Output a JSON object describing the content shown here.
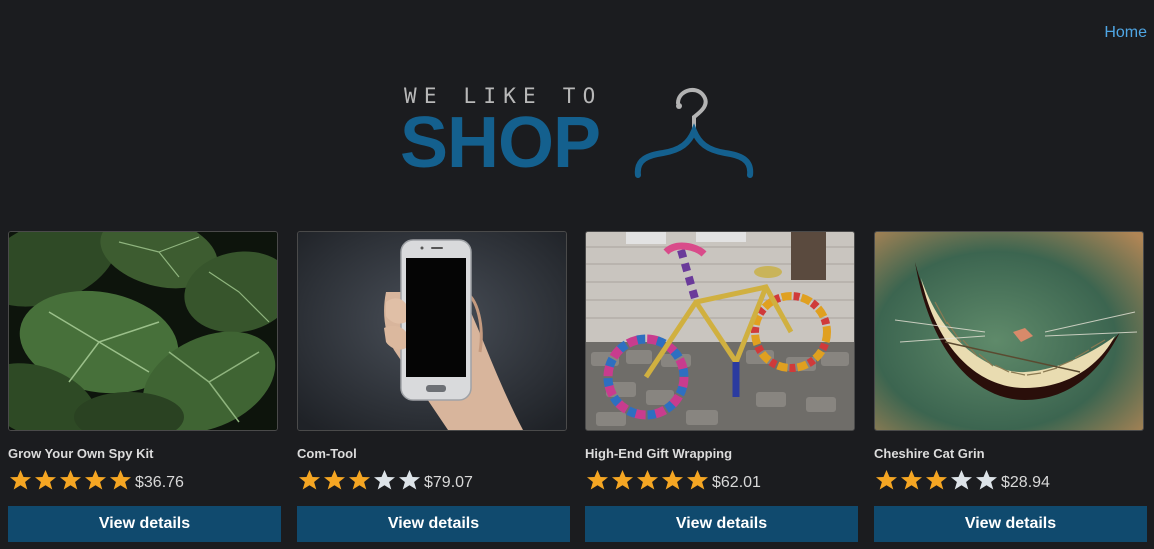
{
  "nav": {
    "home_label": "Home"
  },
  "logo": {
    "tagline": "WE LIKE TO",
    "brand": "SHOP",
    "brand_color": "#14608e"
  },
  "colors": {
    "star_filled": "#f5a623",
    "star_empty": "#dde3e8",
    "button_bg": "#104a6e",
    "link": "#4fa6e4"
  },
  "products": [
    {
      "name": "Grow Your Own Spy Kit",
      "rating": 5,
      "rating_max": 5,
      "price": "$36.76",
      "button_label": "View details",
      "image": "green-leaves-photo"
    },
    {
      "name": "Com-Tool",
      "rating": 3,
      "rating_max": 5,
      "price": "$79.07",
      "button_label": "View details",
      "image": "hand-holding-phone-photo"
    },
    {
      "name": "High-End Gift Wrapping",
      "rating": 5,
      "rating_max": 5,
      "price": "$62.01",
      "button_label": "View details",
      "image": "yarn-bombed-bicycle-photo"
    },
    {
      "name": "Cheshire Cat Grin",
      "rating": 3,
      "rating_max": 5,
      "price": "$28.94",
      "button_label": "View details",
      "image": "cheshire-cat-grin-art"
    }
  ]
}
